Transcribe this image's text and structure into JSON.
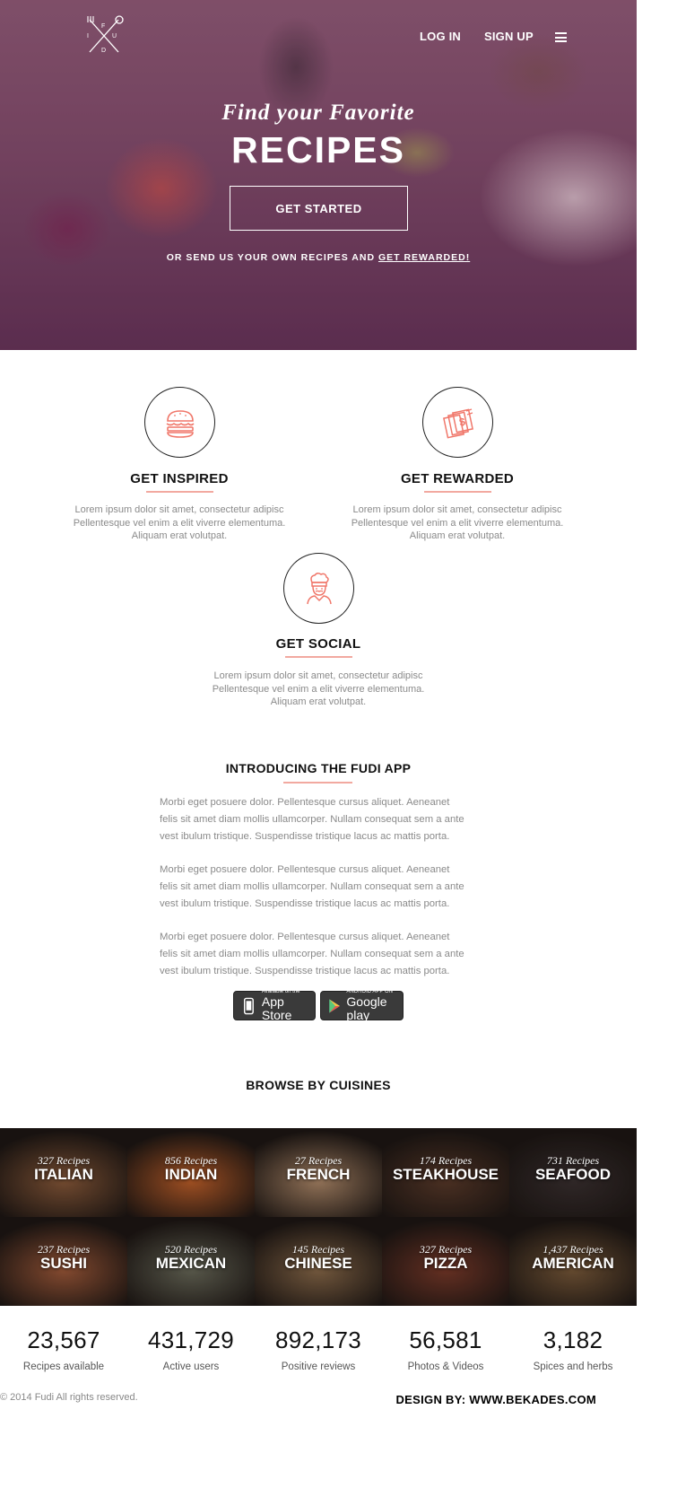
{
  "nav": {
    "login": "LOG IN",
    "signup": "SIGN UP",
    "logo_letters": [
      "F",
      "U",
      "D",
      "I"
    ]
  },
  "hero": {
    "kicker": "Find your Favorite",
    "title": "RECIPES",
    "cta": "GET STARTED",
    "note_prefix": "OR SEND US YOUR OWN RECIPES AND ",
    "note_link": "GET REWARDED!"
  },
  "features": [
    {
      "title": "GET INSPIRED",
      "icon": "burger-icon",
      "lines": [
        "Lorem ipsum dolor sit amet, consectetur adipisc",
        "Pellentesque vel enim a elit viverre elementuma.",
        "Aliquam erat volutpat."
      ]
    },
    {
      "title": "GET REWARDED",
      "icon": "money-stack-icon",
      "lines": [
        "Lorem ipsum dolor sit amet, consectetur adipisc",
        "Pellentesque vel enim a elit viverre elementuma.",
        "Aliquam erat volutpat."
      ]
    },
    {
      "title": "GET SOCIAL",
      "icon": "chef-icon",
      "lines": [
        "Lorem ipsum dolor sit amet, consectetur adipisc",
        "Pellentesque vel enim a elit viverre elementuma.",
        "Aliquam erat volutpat."
      ]
    }
  ],
  "intro": {
    "title": "INTRODUCING THE FUDI APP",
    "paragraphs": [
      [
        "Morbi eget posuere dolor. Pellentesque cursus aliquet. Aeneanet",
        "felis sit amet diam mollis ullamcorper. Nullam consequat sem a ante",
        "vest ibulum tristique. Suspendisse tristique lacus ac mattis porta."
      ],
      [
        "Morbi eget posuere dolor. Pellentesque cursus aliquet. Aeneanet",
        "felis sit amet diam mollis ullamcorper. Nullam consequat sem a ante",
        "vest ibulum tristique. Suspendisse tristique lacus ac mattis porta."
      ],
      [
        "Morbi eget posuere dolor. Pellentesque cursus aliquet. Aeneanet",
        "felis sit amet diam mollis ullamcorper. Nullam consequat sem a ante",
        "vest ibulum tristique. Suspendisse tristique lacus ac mattis porta."
      ]
    ],
    "appstore": {
      "small": "Available on the",
      "big": "App Store"
    },
    "googleplay": {
      "small": "ANDROID APP ON",
      "big": "Google play"
    }
  },
  "browse": {
    "title": "BROWSE BY CUISINES",
    "cuisines": [
      {
        "count": "327 Recipes",
        "name": "ITALIAN",
        "color": "#8a5a3a"
      },
      {
        "count": "856 Recipes",
        "name": "INDIAN",
        "color": "#c0602a"
      },
      {
        "count": "27 Recipes",
        "name": "FRENCH",
        "color": "#b08a6a"
      },
      {
        "count": "174 Recipes",
        "name": "STEAKHOUSE",
        "color": "#5a3a2a"
      },
      {
        "count": "731 Recipes",
        "name": "SEAFOOD",
        "color": "#3a3030"
      },
      {
        "count": "237 Recipes",
        "name": "SUSHI",
        "color": "#a05a3a"
      },
      {
        "count": "520 Recipes",
        "name": "MEXICAN",
        "color": "#6a6a5a"
      },
      {
        "count": "145 Recipes",
        "name": "CHINESE",
        "color": "#8a6a4a"
      },
      {
        "count": "327 Recipes",
        "name": "PIZZA",
        "color": "#7a3a2a"
      },
      {
        "count": "1,437 Recipes",
        "name": "AMERICAN",
        "color": "#7a5a3a"
      }
    ]
  },
  "stats": [
    {
      "num": "23,567",
      "label": "Recipes available"
    },
    {
      "num": "431,729",
      "label": "Active users"
    },
    {
      "num": "892,173",
      "label": "Positive reviews"
    },
    {
      "num": "56,581",
      "label": "Photos & Videos"
    },
    {
      "num": "3,182",
      "label": "Spices and herbs"
    }
  ],
  "footer": {
    "copyright": "© 2014 Fudi All rights reserved.",
    "design_by": "DESIGN BY: ",
    "design_site": "WWW.BEKADES.COM"
  },
  "colors": {
    "accent": "#f0776a",
    "rule": "#f2a9a0",
    "body_text": "#8a8a8a"
  }
}
